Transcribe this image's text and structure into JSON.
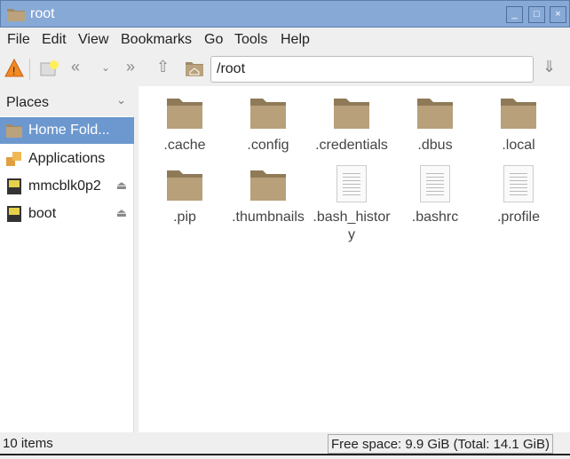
{
  "window": {
    "title": "root",
    "icon": "folder-icon",
    "accent": "#87a9d6"
  },
  "menu": [
    "File",
    "Edit",
    "View",
    "Bookmarks",
    "Go",
    "Tools",
    "Help"
  ],
  "toolbar": {
    "path": "/root"
  },
  "sidebar": {
    "header": "Places",
    "items": [
      {
        "label": "Home Fold...",
        "icon": "home-folder-icon",
        "selected": true
      },
      {
        "label": "Applications",
        "icon": "applications-icon"
      },
      {
        "label": "mmcblk0p2",
        "icon": "drive-icon",
        "eject": true
      },
      {
        "label": "boot",
        "icon": "drive-icon",
        "eject": true
      }
    ]
  },
  "files": [
    {
      "name": ".cache",
      "type": "folder"
    },
    {
      "name": ".config",
      "type": "folder"
    },
    {
      "name": ".credentials",
      "type": "folder"
    },
    {
      "name": ".dbus",
      "type": "folder"
    },
    {
      "name": ".local",
      "type": "folder"
    },
    {
      "name": ".pip",
      "type": "folder"
    },
    {
      "name": ".thumbnails",
      "type": "folder"
    },
    {
      "name": ".bash_history",
      "type": "file"
    },
    {
      "name": ".bashrc",
      "type": "file"
    },
    {
      "name": ".profile",
      "type": "file"
    }
  ],
  "status": {
    "count": "10 items",
    "free": "Free space: 9.9 GiB (Total: 14.1 GiB)"
  }
}
